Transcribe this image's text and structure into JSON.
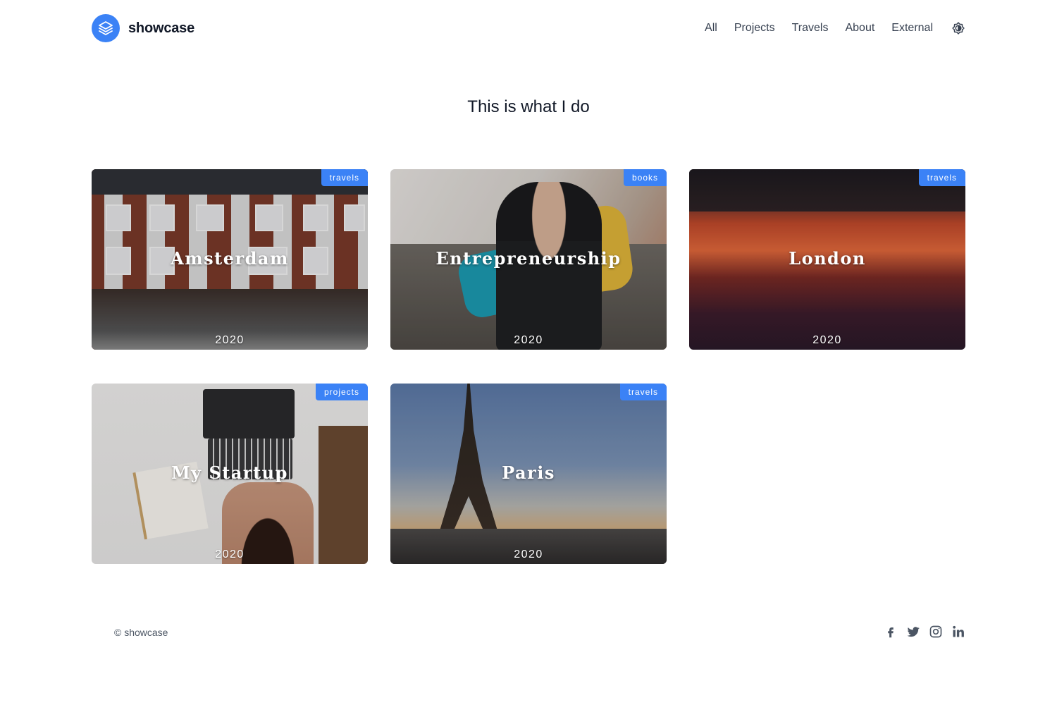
{
  "header": {
    "brand_name": "showcase",
    "nav": [
      {
        "label": "All"
      },
      {
        "label": "Projects"
      },
      {
        "label": "Travels"
      },
      {
        "label": "About"
      },
      {
        "label": "External"
      }
    ]
  },
  "main": {
    "title": "This is what I do",
    "cards": [
      {
        "title": "Amsterdam",
        "year": "2020",
        "tag": "travels"
      },
      {
        "title": "Entrepreneurship",
        "year": "2020",
        "tag": "books"
      },
      {
        "title": "London",
        "year": "2020",
        "tag": "travels"
      },
      {
        "title": "My Startup",
        "year": "2020",
        "tag": "projects"
      },
      {
        "title": "Paris",
        "year": "2020",
        "tag": "travels"
      }
    ]
  },
  "footer": {
    "copyright": "© showcase",
    "socials": [
      "facebook-icon",
      "twitter-icon",
      "instagram-icon",
      "linkedin-icon"
    ]
  },
  "colors": {
    "accent": "#3b82f6",
    "text": "#111827",
    "muted": "#4b5563"
  }
}
